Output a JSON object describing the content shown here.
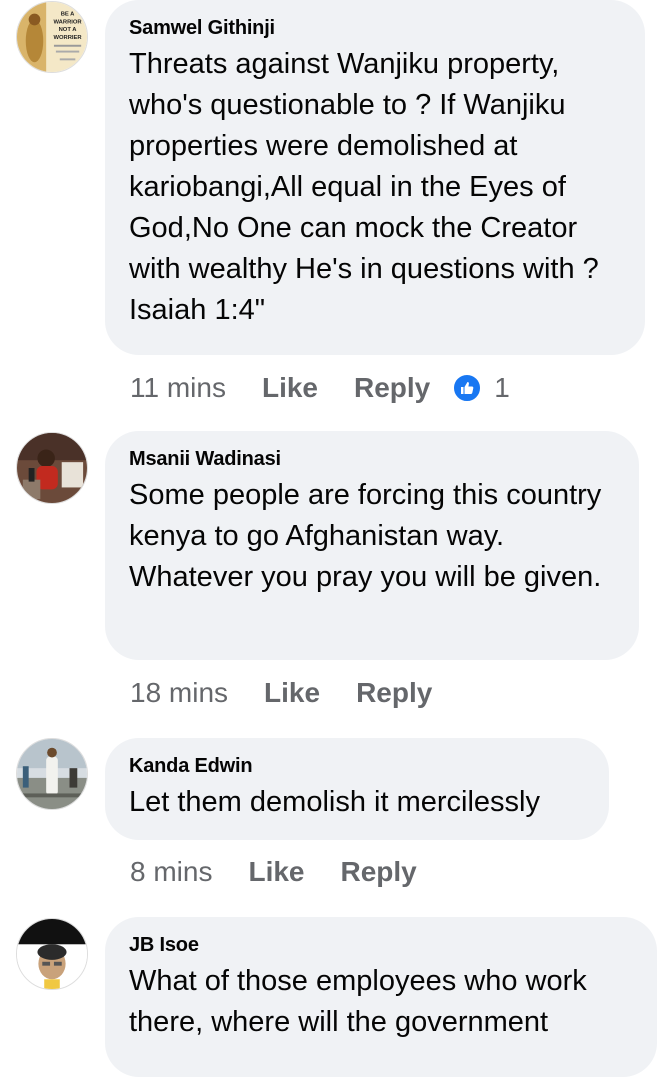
{
  "comments": [
    {
      "author": "Samwel Githinji",
      "text": "Threats against Wanjiku property, who's questionable to ? If Wanjiku properties were demolished at kariobangi,All equal in the Eyes of God,No One can mock the Creator with wealthy He's in questions with ? Isaiah 1:4\"",
      "time": "11 mins",
      "like_label": "Like",
      "reply_label": "Reply",
      "reaction_count": "1",
      "avatar_text": [
        "BE A",
        "WARRIOR",
        "NOT A",
        "WORRIER"
      ]
    },
    {
      "author": "Msanii Wadinasi",
      "text": "Some people are forcing this country kenya to go Afghanistan way. Whatever you pray you will be given.",
      "time": "18 mins",
      "like_label": "Like",
      "reply_label": "Reply"
    },
    {
      "author": "Kanda Edwin",
      "text": "Let them demolish it mercilessly",
      "time": "8 mins",
      "like_label": "Like",
      "reply_label": "Reply"
    },
    {
      "author": "JB Isoe",
      "text": "What of those employees who work there, where will the government"
    }
  ],
  "colors": {
    "bubble": "#f0f2f5",
    "meta_text": "#65676b",
    "like_reaction": "#1877f2"
  }
}
